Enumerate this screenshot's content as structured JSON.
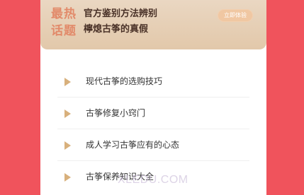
{
  "banner": {
    "tag_line1": "最热",
    "tag_line2": "话题",
    "title_line1": "官方鉴别方法辨别",
    "title_line2": "檸熄古筝的真假",
    "button_label": "立即体验"
  },
  "list": {
    "items": [
      {
        "label": "现代古筝的选购技巧"
      },
      {
        "label": "古筝修复小窍门"
      },
      {
        "label": "成人学习古筝应有的心态"
      },
      {
        "label": "古筝保养知识大全"
      }
    ]
  },
  "watermark": {
    "text": "XLEDU.COM"
  },
  "colors": {
    "page_background": "#f0535c",
    "banner_background": "#ead7c2",
    "tag_color": "#e28a6a",
    "button_background": "#f0c7a2",
    "arrow_color": "#d8b07c"
  }
}
